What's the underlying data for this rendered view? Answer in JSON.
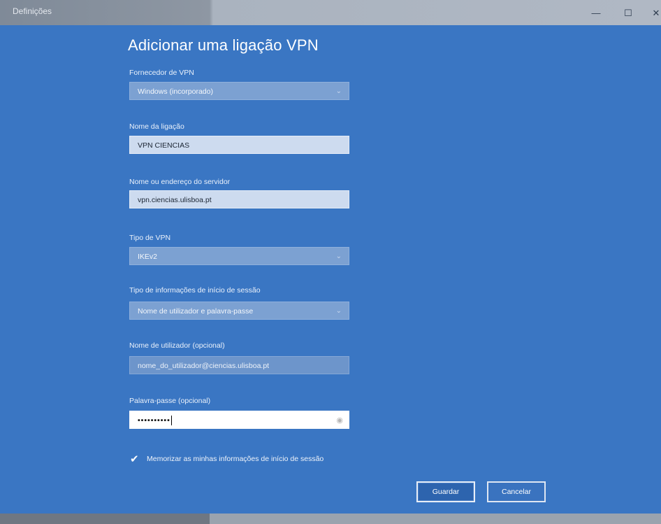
{
  "window": {
    "title": "Definições",
    "controls": {
      "minimize": "—",
      "maximize": "☐",
      "close": "✕"
    }
  },
  "page": {
    "heading": "Adicionar uma ligação VPN"
  },
  "form": {
    "vpn_provider": {
      "label": "Fornecedor de VPN",
      "value": "Windows (incorporado)"
    },
    "connection_name": {
      "label": "Nome da ligação",
      "value": "VPN CIENCIAS"
    },
    "server": {
      "label": "Nome ou endereço do servidor",
      "value": "vpn.ciencias.ulisboa.pt"
    },
    "vpn_type": {
      "label": "Tipo de VPN",
      "value": "IKEv2"
    },
    "signin_type": {
      "label": "Tipo de informações de início de sessão",
      "value": "Nome de utilizador e palavra-passe"
    },
    "username": {
      "label": "Nome de utilizador (opcional)",
      "value": "nome_do_utilizador@ciencias.ulisboa.pt"
    },
    "password": {
      "label": "Palavra-passe (opcional)",
      "value": "••••••••••"
    },
    "remember": {
      "label": "Memorizar as minhas informações de início de sessão",
      "checked": true
    }
  },
  "buttons": {
    "save": "Guardar",
    "cancel": "Cancelar"
  },
  "icons": {
    "chevron": "chevron-down-icon",
    "check": "checkmark-icon",
    "reveal": "eye-icon"
  },
  "colors": {
    "accent": "#3a76c3",
    "field_dropdown": "#7ca1d2",
    "field_text": "#cddbef"
  }
}
